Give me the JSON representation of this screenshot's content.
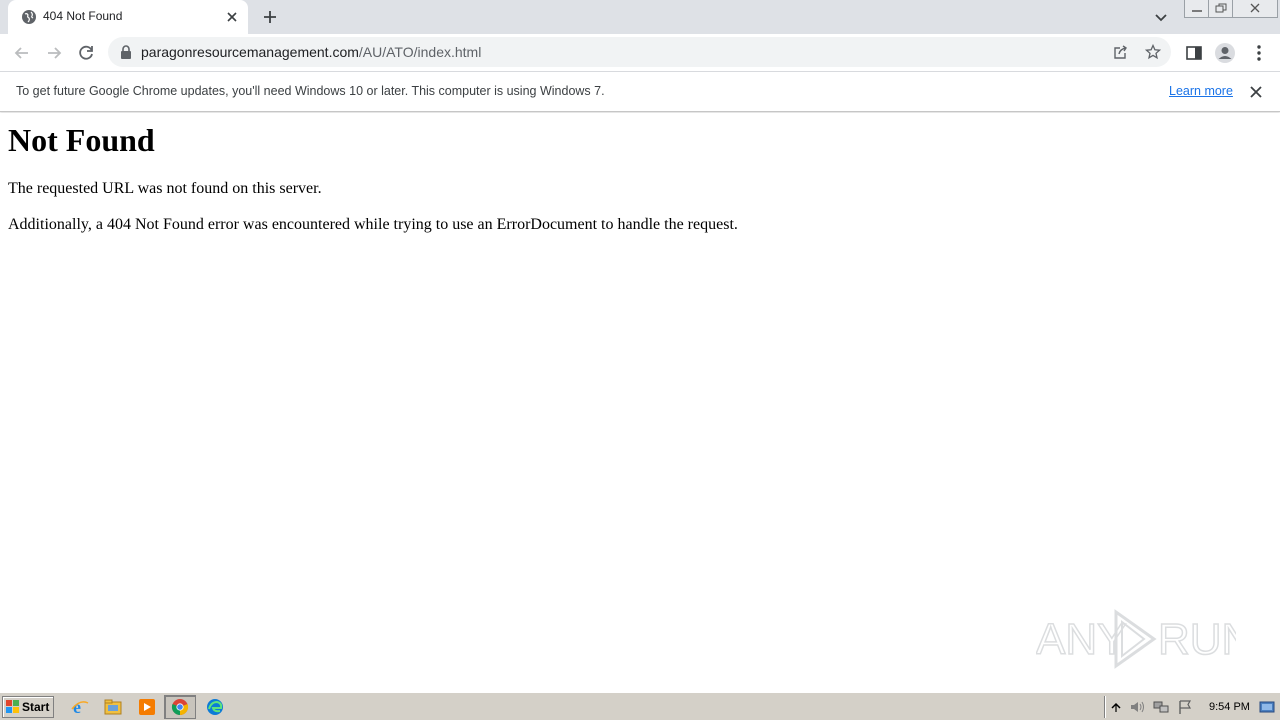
{
  "browser": {
    "tab": {
      "title": "404 Not Found"
    },
    "address": {
      "domain": "paragonresourcemanagement.com",
      "path": "/AU/ATO/index.html"
    },
    "infobar": {
      "message": "To get future Google Chrome updates, you'll need Windows 10 or later. This computer is using Windows 7.",
      "link": "Learn more"
    },
    "icons": {
      "back": "back-arrow-icon",
      "forward": "forward-arrow-icon",
      "reload": "reload-icon",
      "lock": "lock-icon",
      "share": "share-icon",
      "bookmark": "star-icon",
      "side_panel": "side-panel-icon",
      "profile": "profile-icon",
      "menu": "kebab-menu-icon"
    }
  },
  "page": {
    "heading": "Not Found",
    "paragraph1": "The requested URL was not found on this server.",
    "paragraph2": "Additionally, a 404 Not Found error was encountered while trying to use an ErrorDocument to handle the request."
  },
  "watermark": {
    "text": "ANY RUN"
  },
  "taskbar": {
    "start_label": "Start",
    "apps": [
      "internet-explorer-icon",
      "file-explorer-icon",
      "media-player-icon",
      "chrome-icon",
      "edge-icon"
    ],
    "clock": "9:54 PM"
  }
}
